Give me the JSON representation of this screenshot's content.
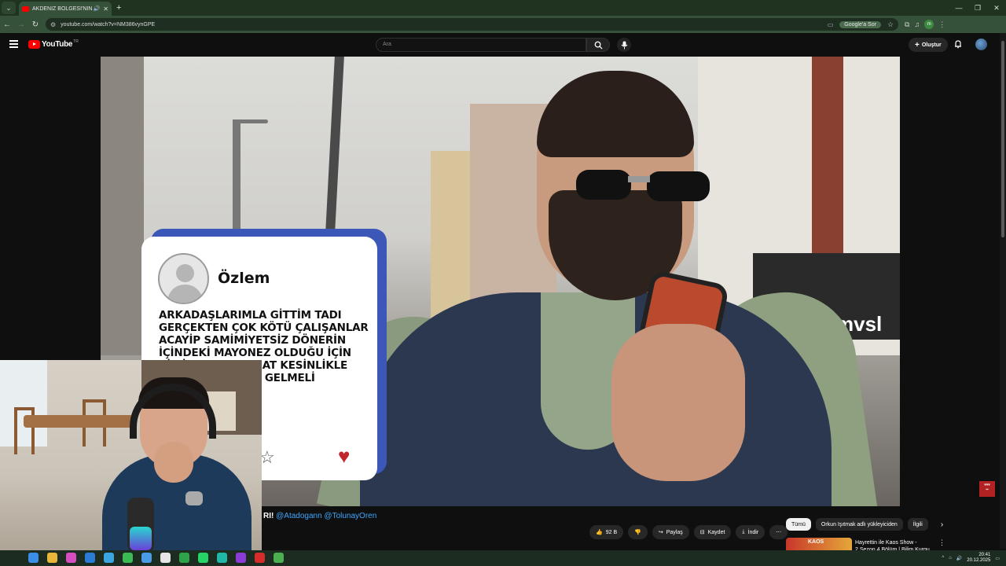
{
  "browser": {
    "tab_title": "AKDENİZ BÖLGESİ'NİN EN İ",
    "url": "youtube.com/watch?v=NM386vynGPE",
    "google_ask": "Google'a Sor",
    "profile_initial": "m"
  },
  "youtube": {
    "logo_text": "YouTube",
    "logo_country": "TR",
    "search_placeholder": "Ara",
    "create_label": "Oluştur"
  },
  "video_overlay": {
    "reviewer_name": "Özlem",
    "review_text": "ARKADAŞLARIMLA GİTTİM TADI GERÇEKTEN ÇOK KÖTÜ ÇALIŞANLAR ACAYİP SAMİMİYETSİZ DÖNERİN İÇİNDEKİ MAYONEZ OLDUĞU İÇİN BİR İYORUM AMA AT KESİNLİKLE RKUN IŞITMAK LE GELMELİ",
    "street_sign": "mvsl"
  },
  "video_info": {
    "title_visible": "RI!",
    "mentions": "@Atadogann @TolunayOren",
    "actions": {
      "like_count": "92 B",
      "share": "Paylaş",
      "save": "Kaydet",
      "download": "İndir"
    },
    "chips": [
      "Tümü",
      "Orkun Işıtmak adlı yükleyiciden",
      "İlgili"
    ],
    "recommendation": {
      "thumb_text": "KAOS",
      "title": "Hayrettin ile Kaos Show - 2.Sezon 4.Bölüm | Bilim Kurgu"
    }
  },
  "taskbar": {
    "time": "20:41",
    "date": "20.12.2025"
  }
}
